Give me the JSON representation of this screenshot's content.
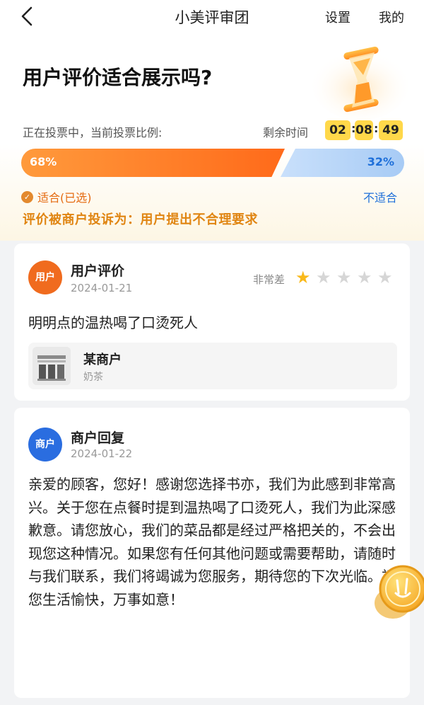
{
  "nav": {
    "title": "小美评审团",
    "settings": "设置",
    "mine": "我的"
  },
  "header": {
    "title": "用户评价适合展示吗?"
  },
  "vote": {
    "status": "正在投票中，当前投票比例:",
    "remaining_label": "剩余时间",
    "time": {
      "hours": "02",
      "minutes": "08",
      "seconds": "49"
    },
    "suitable_pct_text": "68%",
    "unsuitable_pct_text": "32%",
    "suitable_fraction": 0.68,
    "suitable_label": "适合(已选)",
    "unsuitable_label": "不适合",
    "colors": {
      "suitable": "#ff6a1a",
      "unsuitable": "#a7cbf5"
    }
  },
  "complaint": "评价被商户投诉为：用户提出不合理要求",
  "review": {
    "avatar": "用户",
    "title": "用户评价",
    "date": "2024-01-21",
    "rating_label": "非常差",
    "rating": 1,
    "max_rating": 5,
    "text": "明明点的温热喝了口烫死人",
    "merchant": {
      "name": "某商户",
      "category": "奶茶",
      "icon": "storefront-icon"
    }
  },
  "reply": {
    "avatar": "商户",
    "title": "商户回复",
    "date": "2024-01-22",
    "text": "亲爱的顾客，您好！感谢您选择书亦，我们为此感到非常高兴。关于您在点餐时提到温热喝了口烫死人，我们为此深感歉意。请您放心，我们的菜品都是经过严格把关的，不会出现您这种情况。如果您有任何其他问题或需要帮助，请随时与我们联系，我们将竭诚为您服务，期待您的下次光临。祝您生活愉快，万事如意！"
  }
}
